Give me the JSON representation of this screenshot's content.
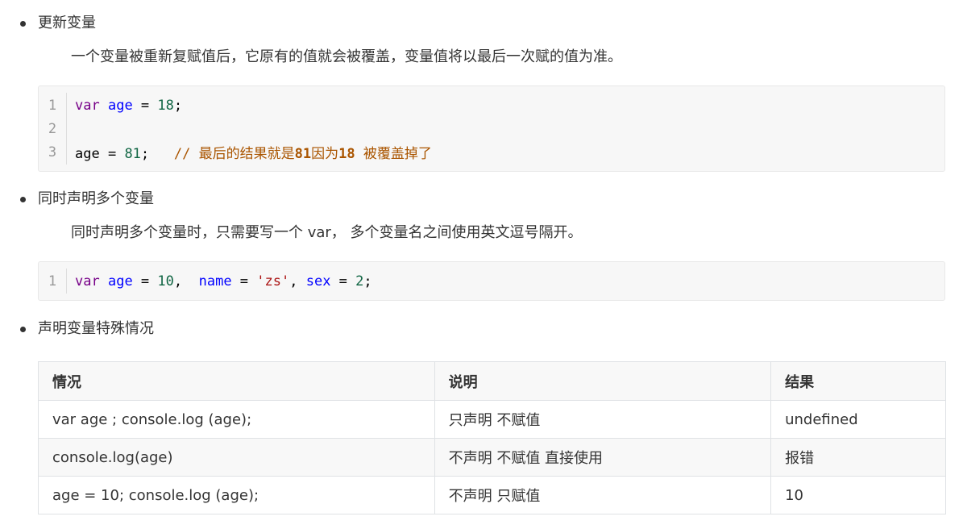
{
  "sections": [
    {
      "bullet": "更新变量",
      "desc": "一个变量被重新复赋值后，它原有的值就会被覆盖，变量值将以最后一次赋的值为准。"
    },
    {
      "bullet": "同时声明多个变量",
      "desc": "同时声明多个变量时，只需要写一个 var， 多个变量名之间使用英文逗号隔开。"
    },
    {
      "bullet": "声明变量特殊情况"
    }
  ],
  "code1": {
    "line_numbers": [
      "1",
      "2",
      "3"
    ],
    "l1": {
      "kw": "var",
      "name": "age",
      "eq": " = ",
      "num": "18",
      "end": ";"
    },
    "l3": {
      "name": "age",
      "eq": " = ",
      "num": "81",
      "end": ";",
      "gap": "   ",
      "c1": "// 最后的结果就是",
      "c2": "81",
      "c3": "因为",
      "c4": "18",
      "c5": " 被覆盖掉了"
    }
  },
  "code2": {
    "line_numbers": [
      "1"
    ],
    "kw": "var",
    "n1": "age",
    "eq": " = ",
    "v1": "10",
    "sep1": ",  ",
    "n2": "name",
    "v2": "'zs'",
    "sep2": ", ",
    "n3": "sex",
    "v3": "2",
    "end": ";"
  },
  "table": {
    "headers": [
      "情况",
      "说明",
      "结果"
    ],
    "rows": [
      [
        "var  age ; console.log (age);",
        "只声明 不赋值",
        "undefined"
      ],
      [
        "console.log(age)",
        "不声明 不赋值  直接使用",
        "报错"
      ],
      [
        "age   = 10; console.log (age);",
        "不声明   只赋值",
        "10"
      ]
    ]
  }
}
